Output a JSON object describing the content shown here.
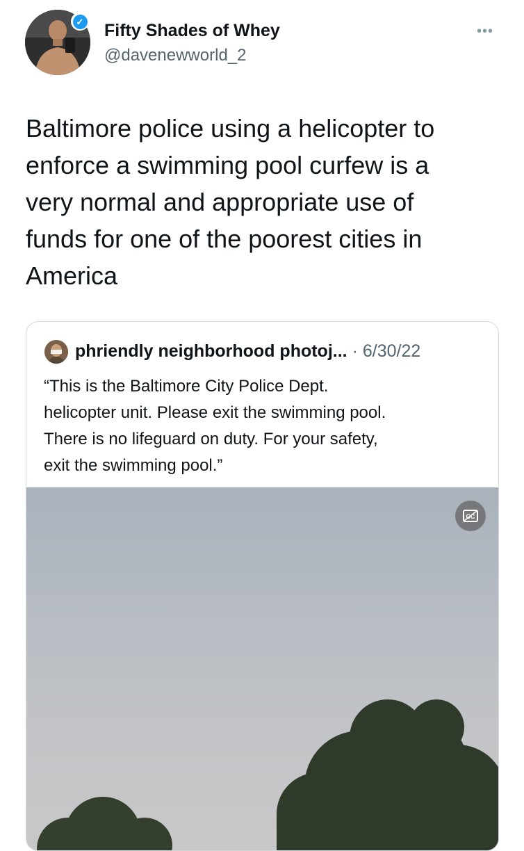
{
  "tweet": {
    "author_name": "Fifty Shades of Whey",
    "author_handle": "@davenewworld_2",
    "verified": true,
    "more_icon": "•••",
    "text": "Baltimore police using a helicopter to\nenforce a swimming pool curfew is a\nvery normal and appropriate use of\nfunds for one of the poorest cities in\nAmerica"
  },
  "quoted": {
    "author_name": "phriendly neighborhood photoj...",
    "separator": " · ",
    "date": "6/30/22",
    "text": "“This is the Baltimore City Police Dept.\nhelicopter unit. Please exit the swimming pool.\nThere is no lifeguard on duty. For your safety,\nexit the swimming pool.”",
    "media": {
      "icon": "closed-captions-icon"
    }
  },
  "colors": {
    "accent": "#1d9bf0",
    "text": "#0f1419",
    "secondary": "#536471",
    "border": "#cfd9de"
  }
}
